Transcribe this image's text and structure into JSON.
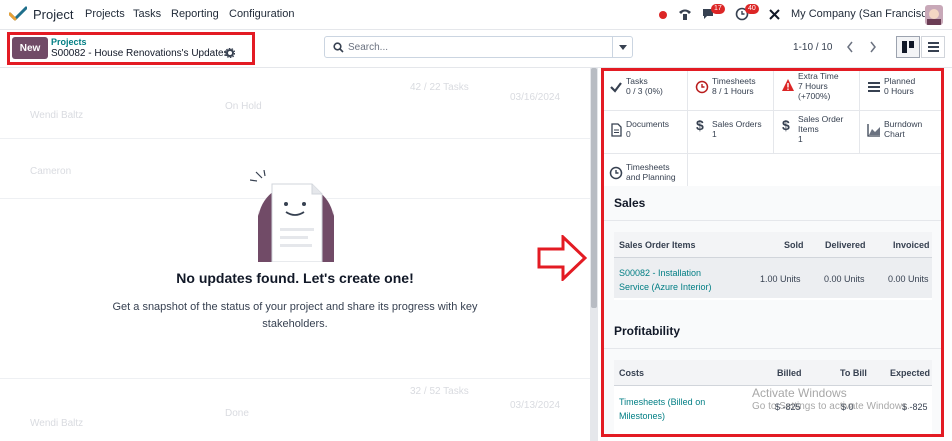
{
  "topnav": {
    "app_name": "Project",
    "menu": [
      "Projects",
      "Tasks",
      "Reporting",
      "Configuration"
    ],
    "chat_count": "17",
    "activity_count": "40",
    "company": "My Company (San Francisco)"
  },
  "control": {
    "new_label": "New",
    "breadcrumb_parent": "Projects",
    "breadcrumb_current": "S00082 - House Renovations's Updates",
    "search_placeholder": "Search...",
    "pager": "1-10 / 10"
  },
  "empty_state": {
    "title": "No updates found. Let's create one!",
    "body": "Get a snapshot of the status of your project and share its progress with key stakeholders."
  },
  "background_rows": {
    "names": [
      "Wendi Baltz",
      "Cameron",
      "Wendi Baltz"
    ],
    "statuses": [
      "On Hold",
      "Done"
    ],
    "dates": [
      "03/16/2024",
      "03/13/2024"
    ],
    "progress_texts": [
      "42 / 22 Tasks",
      "32 / 52 Tasks"
    ]
  },
  "stats": [
    {
      "icon": "check-icon",
      "label": "Tasks",
      "value": "0 / 3 (0%)",
      "color": "#374151"
    },
    {
      "icon": "clock-icon",
      "label": "Timesheets",
      "value": "8 / 1 Hours",
      "color": "#b91c1c"
    },
    {
      "icon": "warning-icon",
      "label": "Extra Time",
      "value": "7 Hours",
      "value2": "(+700%)",
      "color": "#dc2626"
    },
    {
      "icon": "list-icon",
      "label": "Planned",
      "value": "0 Hours",
      "color": "#374151"
    },
    {
      "icon": "document-icon",
      "label": "Documents",
      "value": "0",
      "color": "#374151"
    },
    {
      "icon": "dollar-icon",
      "label": "Sales Orders",
      "value": "1",
      "color": "#374151"
    },
    {
      "icon": "dollar-icon",
      "label": "Sales Order",
      "value": "Items",
      "value2": "1",
      "color": "#374151"
    },
    {
      "icon": "chart-icon",
      "label": "Burndown",
      "value": "Chart",
      "color": "#374151"
    },
    {
      "icon": "clock-icon",
      "label": "Timesheets",
      "value": "and Planning",
      "color": "#374151"
    }
  ],
  "sales": {
    "title": "Sales",
    "headers": [
      "Sales Order Items",
      "Sold",
      "Delivered",
      "Invoiced"
    ],
    "row": {
      "item": "S00082 - Installation Service (Azure Interior)",
      "item_line1": "S00082 - Installation",
      "item_line2": "Service (Azure Interior)",
      "sold": "1.00 Units",
      "delivered": "0.00 Units",
      "invoiced": "0.00 Units"
    }
  },
  "profitability": {
    "title": "Profitability",
    "headers": [
      "Costs",
      "Billed",
      "To Bill",
      "Expected"
    ],
    "row": {
      "item_line1": "Timesheets (Billed on",
      "item_line2": "Milestones)",
      "billed": "$ -825",
      "to_bill": "$ 0",
      "expected": "$ -825"
    }
  },
  "watermark": {
    "line1": "Activate Windows",
    "line2": "Go to Settings to activate Windows."
  },
  "colors": {
    "brand": "#714b67",
    "link": "#017e84",
    "highlight": "#e31b23"
  }
}
